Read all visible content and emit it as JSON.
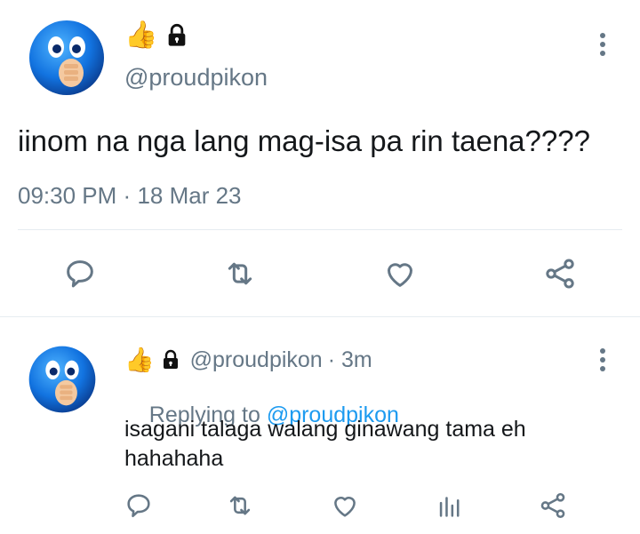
{
  "tweet": {
    "display_name_emoji": "👍",
    "handle": "@proudpikon",
    "text": "iinom na nga lang mag-isa pa rin taena????",
    "time": "09:30 PM",
    "dot": "·",
    "date": "18 Mar 23",
    "icons": [
      "reply-icon",
      "retweet-icon",
      "like-icon",
      "share-icon"
    ]
  },
  "reply": {
    "display_name_emoji": "👍",
    "handle": "@proudpikon",
    "meta": "· 3m",
    "replying_prefix": "Replying to ",
    "replying_handle": "@proudpikon",
    "text_line1": "isagani talaga walang ginawang tama eh",
    "text_line2": "hahahaha",
    "icons": [
      "reply-icon",
      "retweet-icon",
      "like-icon",
      "analytics-icon",
      "share-icon"
    ]
  },
  "colors": {
    "accent": "#1d9bf0",
    "muted": "#657786",
    "icon": "#657786",
    "divider": "#e6ecf0"
  }
}
